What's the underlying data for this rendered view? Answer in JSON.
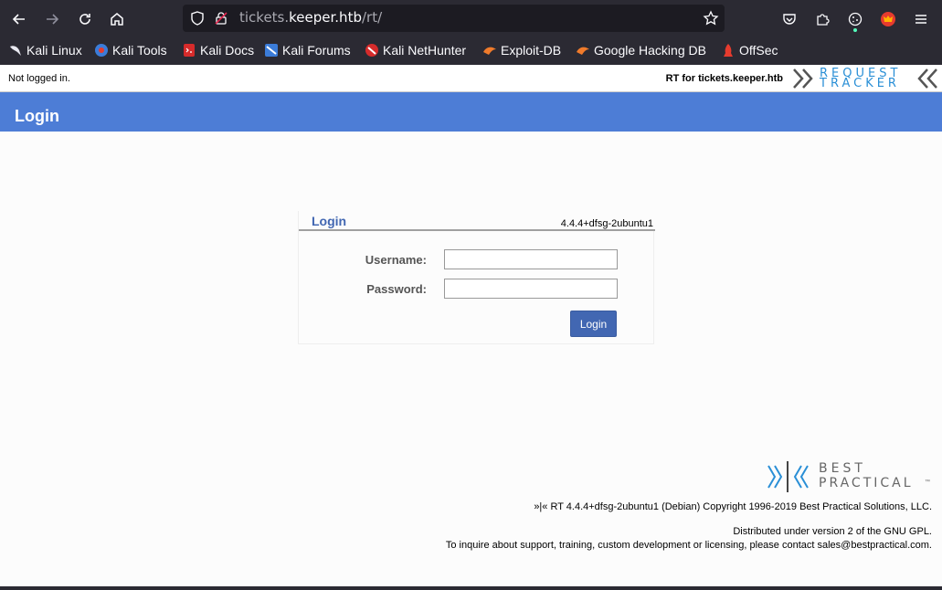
{
  "browser": {
    "url_host_prefix": "tickets.",
    "url_host": "keeper.htb",
    "url_path": "/rt/",
    "bookmarks": [
      {
        "label": "Kali Linux",
        "icon": "kali-dragon-icon"
      },
      {
        "label": "Kali Tools",
        "icon": "kali-tools-icon"
      },
      {
        "label": "Kali Docs",
        "icon": "kali-docs-icon"
      },
      {
        "label": "Kali Forums",
        "icon": "kali-forums-icon"
      },
      {
        "label": "Kali NetHunter",
        "icon": "nethunter-icon"
      },
      {
        "label": "Exploit-DB",
        "icon": "exploit-db-icon"
      },
      {
        "label": "Google Hacking DB",
        "icon": "ghdb-icon"
      },
      {
        "label": "OffSec",
        "icon": "offsec-icon"
      }
    ]
  },
  "rt": {
    "status": "Not logged in.",
    "rt_for": "RT for tickets.keeper.htb",
    "logo_top": "REQUEST",
    "logo_bottom": "TRACKER",
    "page_title": "Login",
    "login": {
      "title": "Login",
      "version": "4.4.4+dfsg-2ubuntu1",
      "username_label": "Username:",
      "username_value": "",
      "password_label": "Password:",
      "password_value": "",
      "button_label": "Login"
    },
    "footer": {
      "logo_top": "BEST",
      "logo_bottom": "PRACTICAL",
      "tm": "™",
      "copyright": "»|« RT 4.4.4+dfsg-2ubuntu1 (Debian) Copyright 1996-2019 Best Practical Solutions, LLC.",
      "license": "Distributed under version 2 of the GNU GPL.",
      "contact": "To inquire about support, training, custom development or licensing, please contact sales@bestpractical.com."
    }
  },
  "colors": {
    "accent": "#4d7dd6",
    "button": "#4267b2",
    "chrome": "#2b2a33"
  }
}
